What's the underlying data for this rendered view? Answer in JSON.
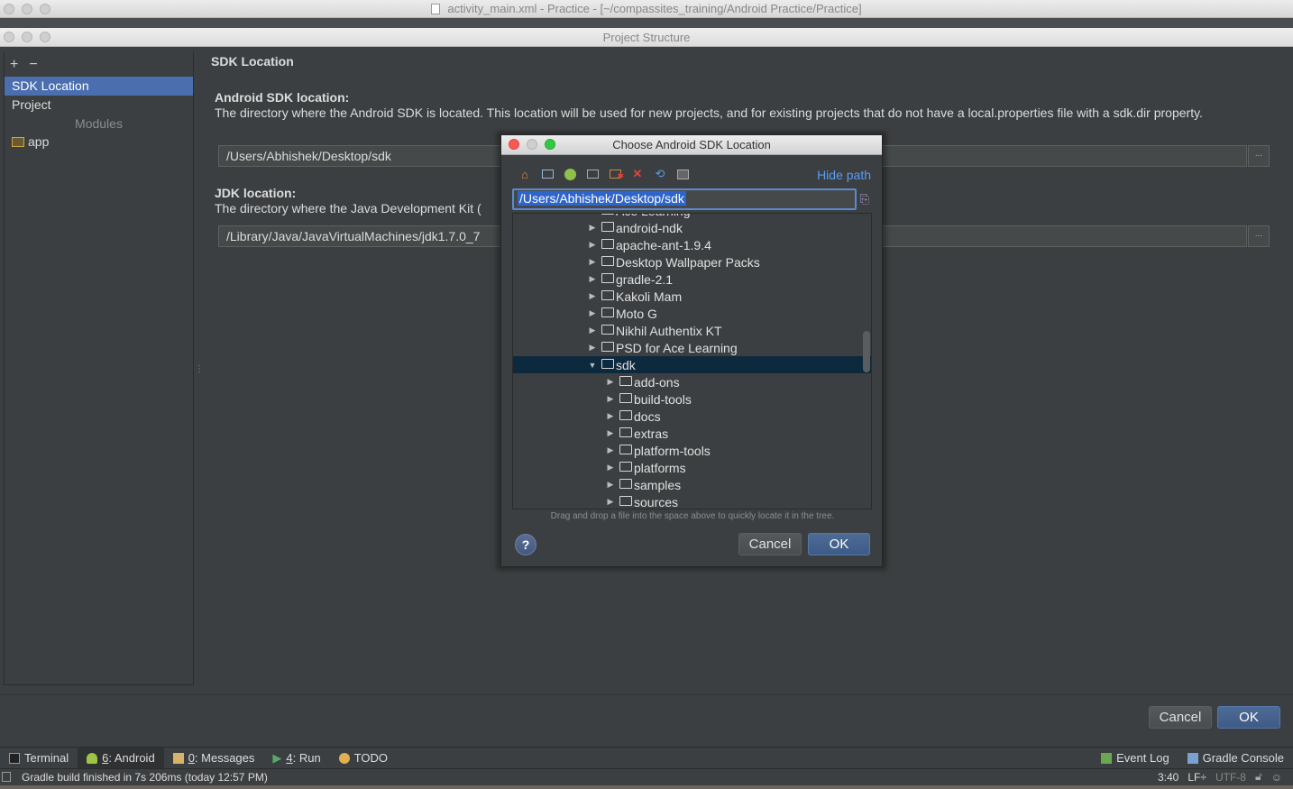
{
  "ide_window": {
    "title": "activity_main.xml - Practice - [~/compassites_training/Android Practice/Practice]"
  },
  "project_structure": {
    "title": "Project Structure",
    "sidebar": {
      "add": "+",
      "remove": "−",
      "items": [
        {
          "label": "SDK Location",
          "selected": true
        },
        {
          "label": "Project",
          "selected": false
        }
      ],
      "modules_header": "Modules",
      "modules": [
        {
          "label": "app"
        }
      ]
    },
    "section_title": "SDK Location",
    "android_sdk": {
      "title": "Android SDK location:",
      "description": "The directory where the Android SDK is located. This location will be used for new projects, and for existing projects that do not have a local.properties file with a sdk.dir property.",
      "value": "/Users/Abhishek/Desktop/sdk",
      "browse": "..."
    },
    "jdk": {
      "title": "JDK location:",
      "description": "The directory where the Java Development Kit (",
      "value": "/Library/Java/JavaVirtualMachines/jdk1.7.0_7",
      "browse": "..."
    },
    "cancel_label": "Cancel",
    "ok_label": "OK"
  },
  "dialog": {
    "title": "Choose Android SDK Location",
    "hide_path": "Hide path",
    "path_value": "/Users/Abhishek/Desktop/sdk",
    "toolbar_icons": [
      "home-icon",
      "desktop-icon",
      "android-icon",
      "folder-icon",
      "new-folder-icon",
      "delete-icon",
      "refresh-icon",
      "show-hidden-icon"
    ],
    "tree": [
      {
        "label": "Ace Learning",
        "depth": 0,
        "expanded": false,
        "partial": true
      },
      {
        "label": "android-ndk",
        "depth": 0,
        "expanded": false
      },
      {
        "label": "apache-ant-1.9.4",
        "depth": 0,
        "expanded": false
      },
      {
        "label": "Desktop Wallpaper Packs",
        "depth": 0,
        "expanded": false
      },
      {
        "label": "gradle-2.1",
        "depth": 0,
        "expanded": false
      },
      {
        "label": "Kakoli Mam",
        "depth": 0,
        "expanded": false
      },
      {
        "label": "Moto G",
        "depth": 0,
        "expanded": false
      },
      {
        "label": "Nikhil Authentix KT",
        "depth": 0,
        "expanded": false
      },
      {
        "label": "PSD for Ace Learning",
        "depth": 0,
        "expanded": false
      },
      {
        "label": "sdk",
        "depth": 0,
        "expanded": true,
        "selected": true
      },
      {
        "label": "add-ons",
        "depth": 1,
        "expanded": false
      },
      {
        "label": "build-tools",
        "depth": 1,
        "expanded": false
      },
      {
        "label": "docs",
        "depth": 1,
        "expanded": false
      },
      {
        "label": "extras",
        "depth": 1,
        "expanded": false
      },
      {
        "label": "platform-tools",
        "depth": 1,
        "expanded": false
      },
      {
        "label": "platforms",
        "depth": 1,
        "expanded": false
      },
      {
        "label": "samples",
        "depth": 1,
        "expanded": false
      },
      {
        "label": "sources",
        "depth": 1,
        "expanded": false
      }
    ],
    "hint": "Drag and drop a file into the space above to quickly locate it in the tree.",
    "help_label": "?",
    "cancel_label": "Cancel",
    "ok_label": "OK"
  },
  "tool_windows": {
    "left": [
      {
        "label": "Terminal",
        "prefix": "",
        "icon": "terminal-icon",
        "active": false
      },
      {
        "label": ": Android",
        "prefix": "6",
        "icon": "android-icon",
        "active": true
      },
      {
        "label": ": Messages",
        "prefix": "0",
        "icon": "messages-icon",
        "active": false
      },
      {
        "label": ": Run",
        "prefix": "4",
        "icon": "run-icon",
        "active": false
      },
      {
        "label": "TODO",
        "prefix": "",
        "icon": "todo-icon",
        "active": false
      }
    ],
    "right": [
      {
        "label": "Event Log",
        "icon": "event-log-icon"
      },
      {
        "label": "Gradle Console",
        "icon": "gradle-console-icon"
      }
    ]
  },
  "status_bar": {
    "message": "Gradle build finished in 7s 206ms (today 12:57 PM)",
    "position": "3:40",
    "line_separator": "LF÷",
    "encoding": "UTF-8"
  }
}
